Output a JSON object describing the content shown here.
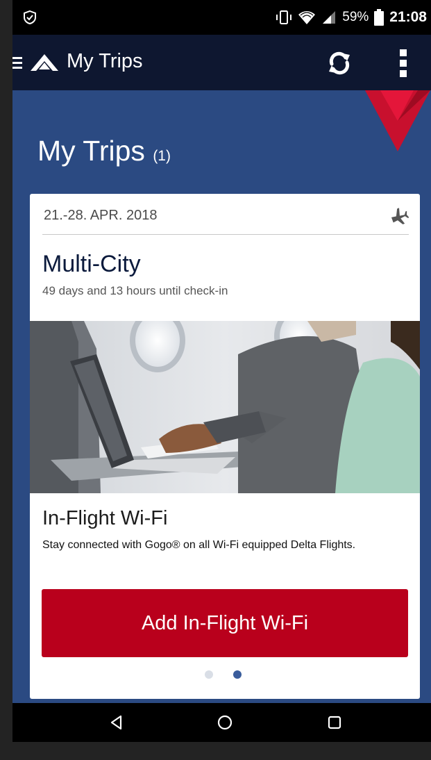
{
  "statusbar": {
    "battery_percent": "59%",
    "time": "21:08",
    "icons": [
      "shield-icon",
      "vibrate-icon",
      "wifi-icon",
      "signal-icon",
      "battery-icon"
    ]
  },
  "appbar": {
    "title": "My Trips",
    "icons": [
      "menu-icon",
      "delta-logo",
      "refresh-icon",
      "more-vert-icon"
    ]
  },
  "page": {
    "title": "My Trips",
    "count": "(1)"
  },
  "trip": {
    "dates": "21.-28. APR. 2018",
    "type": "Multi-City",
    "countdown": "49 days and 13 hours until check-in",
    "icon": "airplane-icon"
  },
  "promo": {
    "title": "In-Flight Wi-Fi",
    "description": "Stay connected with Gogo® on all Wi-Fi equipped Delta Flights.",
    "cta_label": "Add In-Flight Wi-Fi",
    "pages_total": 2,
    "active_page": 2
  },
  "navbar": {
    "icons": [
      "back-icon",
      "home-icon",
      "recents-icon"
    ]
  },
  "colors": {
    "appbar": "#0e1730",
    "content_bg": "#2b4a82",
    "cta": "#b9001c",
    "dot_active": "#3a5d9c",
    "dot_inactive": "#d9dee6"
  }
}
